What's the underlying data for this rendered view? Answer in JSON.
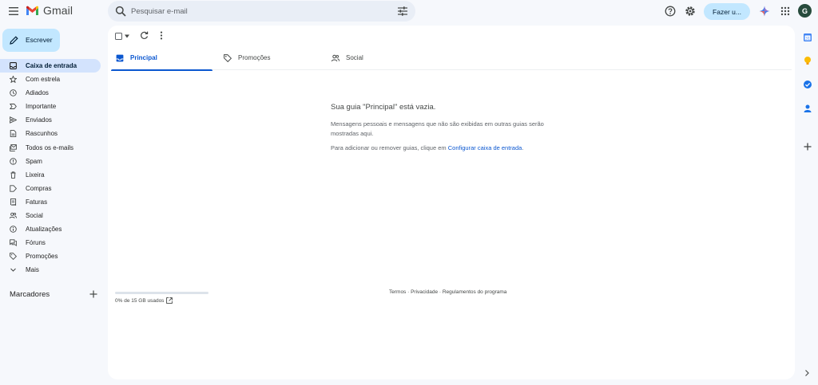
{
  "header": {
    "brand": "Gmail",
    "search_placeholder": "Pesquisar e-mail",
    "upgrade_label": "Fazer u...",
    "avatar_initial": "G"
  },
  "compose": {
    "label": "Escrever"
  },
  "sidebar": {
    "items": [
      {
        "label": "Caixa de entrada",
        "icon": "inbox-icon",
        "active": true
      },
      {
        "label": "Com estrela",
        "icon": "star-icon"
      },
      {
        "label": "Adiados",
        "icon": "clock-icon"
      },
      {
        "label": "Importante",
        "icon": "important-icon"
      },
      {
        "label": "Enviados",
        "icon": "send-icon"
      },
      {
        "label": "Rascunhos",
        "icon": "draft-icon"
      },
      {
        "label": "Todos os e-mails",
        "icon": "all-mail-icon"
      },
      {
        "label": "Spam",
        "icon": "spam-icon"
      },
      {
        "label": "Lixeira",
        "icon": "trash-icon"
      },
      {
        "label": "Compras",
        "icon": "label-icon"
      },
      {
        "label": "Faturas",
        "icon": "receipt-icon"
      },
      {
        "label": "Social",
        "icon": "people-icon"
      },
      {
        "label": "Atualizações",
        "icon": "info-icon"
      },
      {
        "label": "Fóruns",
        "icon": "forum-icon"
      },
      {
        "label": "Promoções",
        "icon": "tag-icon"
      },
      {
        "label": "Mais",
        "icon": "chevron-down-icon"
      }
    ],
    "labels_title": "Marcadores"
  },
  "tabs": [
    {
      "label": "Principal",
      "icon": "inbox-icon",
      "active": true
    },
    {
      "label": "Promoções",
      "icon": "tag-icon"
    },
    {
      "label": "Social",
      "icon": "people-icon"
    }
  ],
  "empty_state": {
    "title": "Sua guia \"Principal\" está vazia.",
    "description": "Mensagens pessoais e mensagens que não são exibidas em outras guias serão mostradas aqui.",
    "hint_prefix": "Para adicionar ou remover guias, clique em ",
    "hint_link": "Configurar caixa de entrada",
    "hint_suffix": "."
  },
  "footer": {
    "storage_text": "0% de 15 GB usados",
    "storage_fraction": 0,
    "terms": "Termos",
    "privacy": "Privacidade",
    "program": "Regulamentos do programa",
    "separator": " · "
  },
  "colors": {
    "background": "#f6f8fc",
    "accent": "#0b57d0",
    "compose_bg": "#c2e7ff",
    "active_item_bg": "#d3e3fd",
    "avatar_bg": "#274b3c"
  }
}
